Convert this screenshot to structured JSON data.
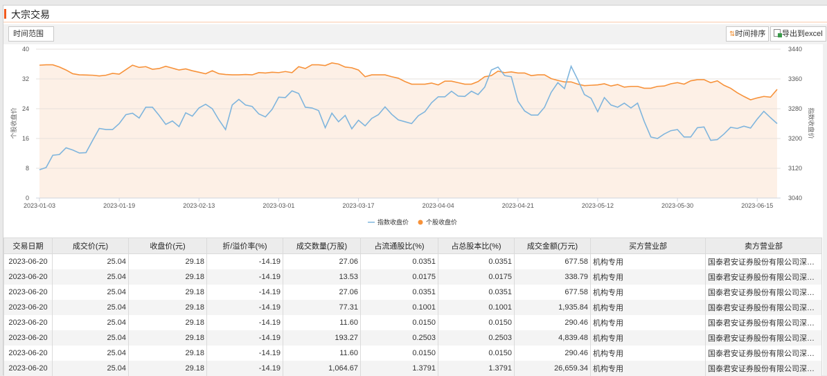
{
  "header": {
    "title": "大宗交易"
  },
  "toolbar": {
    "time_range": "时间范围",
    "sort_label": "时间排序",
    "export_label": "导出到excel"
  },
  "chart_data": {
    "type": "line",
    "left_axis": {
      "label": "个股收盘价",
      "ticks": [
        "0",
        "8",
        "16",
        "24",
        "32",
        "40"
      ],
      "range": [
        0,
        40
      ]
    },
    "right_axis": {
      "label": "指数收盘价",
      "ticks": [
        "3040",
        "3120",
        "3200",
        "3280",
        "3360",
        "3440"
      ],
      "range": [
        3040,
        3440
      ]
    },
    "x_ticks": [
      {
        "index": 0,
        "label": "2023-01-03"
      },
      {
        "index": 12,
        "label": "2023-01-19"
      },
      {
        "index": 24,
        "label": "2023-02-13"
      },
      {
        "index": 36,
        "label": "2023-03-01"
      },
      {
        "index": 48,
        "label": "2023-03-17"
      },
      {
        "index": 60,
        "label": "2023-04-04"
      },
      {
        "index": 72,
        "label": "2023-04-21"
      },
      {
        "index": 84,
        "label": "2023-05-12"
      },
      {
        "index": 96,
        "label": "2023-05-30"
      },
      {
        "index": 108,
        "label": "2023-06-15"
      }
    ],
    "legend": {
      "position": "bottom-center",
      "items": [
        {
          "name": "指数收盘价",
          "color": "#7fb5dd"
        },
        {
          "name": "个股收盘价",
          "color": "#f7923a"
        }
      ]
    },
    "series": [
      {
        "name": "指数收盘价",
        "axis": "right",
        "color": "#7fb5dd",
        "values": [
          3116,
          3122,
          3155,
          3157,
          3175,
          3169,
          3161,
          3162,
          3195,
          3227,
          3224,
          3224,
          3240,
          3264,
          3268,
          3255,
          3284,
          3284,
          3262,
          3238,
          3247,
          3232,
          3269,
          3260,
          3282,
          3292,
          3280,
          3250,
          3224,
          3290,
          3305,
          3290,
          3286,
          3266,
          3258,
          3278,
          3311,
          3310,
          3328,
          3321,
          3284,
          3282,
          3275,
          3229,
          3268,
          3245,
          3262,
          3226,
          3249,
          3234,
          3254,
          3264,
          3285,
          3265,
          3250,
          3245,
          3240,
          3261,
          3272,
          3296,
          3312,
          3312,
          3327,
          3314,
          3313,
          3327,
          3318,
          3338,
          3384,
          3392,
          3369,
          3366,
          3300,
          3274,
          3263,
          3263,
          3284,
          3324,
          3350,
          3334,
          3394,
          3358,
          3318,
          3308,
          3272,
          3310,
          3290,
          3284,
          3295,
          3282,
          3295,
          3246,
          3204,
          3200,
          3212,
          3221,
          3224,
          3204,
          3204,
          3229,
          3231,
          3195,
          3197,
          3212,
          3230,
          3227,
          3233,
          3228,
          3252,
          3273,
          3256,
          3240
        ]
      },
      {
        "name": "个股收盘价",
        "axis": "left",
        "color": "#f7923a",
        "values": [
          35.7,
          35.8,
          35.8,
          35.2,
          34.4,
          33.4,
          33.1,
          33.05,
          33.0,
          32.8,
          33.0,
          33.5,
          33.3,
          34.5,
          35.7,
          35.1,
          35.3,
          34.6,
          34.8,
          35.4,
          34.9,
          34.4,
          34.7,
          34.2,
          33.8,
          33.4,
          34.2,
          33.4,
          33.2,
          33.1,
          33.1,
          33.2,
          33.1,
          33.7,
          33.6,
          33.8,
          33.7,
          34.0,
          33.7,
          35.3,
          34.8,
          35.8,
          35.8,
          35.6,
          36.3,
          36.0,
          35.2,
          35.0,
          34.4,
          32.6,
          33.1,
          33.1,
          33.1,
          32.6,
          32.2,
          31.3,
          30.6,
          30.6,
          30.6,
          30.9,
          30.4,
          31.4,
          31.4,
          31.0,
          30.6,
          30.6,
          31.3,
          32.6,
          32.9,
          34.1,
          33.7,
          33.9,
          33.6,
          33.6,
          32.9,
          33.1,
          33.1,
          32.1,
          31.6,
          31.2,
          31.2,
          30.6,
          30.2,
          30.3,
          30.4,
          30.7,
          30.1,
          30.5,
          29.8,
          30.0,
          30.0,
          29.5,
          29.5,
          30.0,
          30.1,
          30.7,
          31.0,
          30.6,
          31.5,
          31.8,
          31.8,
          31.0,
          31.5,
          30.3,
          29.5,
          28.3,
          27.3,
          26.4,
          26.9,
          27.3,
          27.1,
          29.2
        ]
      }
    ]
  },
  "table": {
    "columns": [
      "交易日期",
      "成交价(元)",
      "收盘价(元)",
      "折/溢价率(%)",
      "成交数量(万股)",
      "占流通股比(%)",
      "占总股本比(%)",
      "成交金额(万元)",
      "买方营业部",
      "卖方营业部"
    ],
    "rows": [
      [
        "2023-06-20",
        "25.04",
        "29.18",
        "-14.19",
        "27.06",
        "0.0351",
        "0.0351",
        "677.58",
        "机构专用",
        "国泰君安证券股份有限公司深圳香..."
      ],
      [
        "2023-06-20",
        "25.04",
        "29.18",
        "-14.19",
        "13.53",
        "0.0175",
        "0.0175",
        "338.79",
        "机构专用",
        "国泰君安证券股份有限公司深圳香..."
      ],
      [
        "2023-06-20",
        "25.04",
        "29.18",
        "-14.19",
        "27.06",
        "0.0351",
        "0.0351",
        "677.58",
        "机构专用",
        "国泰君安证券股份有限公司深圳香..."
      ],
      [
        "2023-06-20",
        "25.04",
        "29.18",
        "-14.19",
        "77.31",
        "0.1001",
        "0.1001",
        "1,935.84",
        "机构专用",
        "国泰君安证券股份有限公司深圳香..."
      ],
      [
        "2023-06-20",
        "25.04",
        "29.18",
        "-14.19",
        "11.60",
        "0.0150",
        "0.0150",
        "290.46",
        "机构专用",
        "国泰君安证券股份有限公司深圳香..."
      ],
      [
        "2023-06-20",
        "25.04",
        "29.18",
        "-14.19",
        "193.27",
        "0.2503",
        "0.2503",
        "4,839.48",
        "机构专用",
        "国泰君安证券股份有限公司深圳香..."
      ],
      [
        "2023-06-20",
        "25.04",
        "29.18",
        "-14.19",
        "11.60",
        "0.0150",
        "0.0150",
        "290.46",
        "机构专用",
        "国泰君安证券股份有限公司深圳香..."
      ],
      [
        "2023-06-20",
        "25.04",
        "29.18",
        "-14.19",
        "1,064.67",
        "1.3791",
        "1.3791",
        "26,659.34",
        "机构专用",
        "国泰君安证券股份有限公司深圳香..."
      ]
    ]
  }
}
